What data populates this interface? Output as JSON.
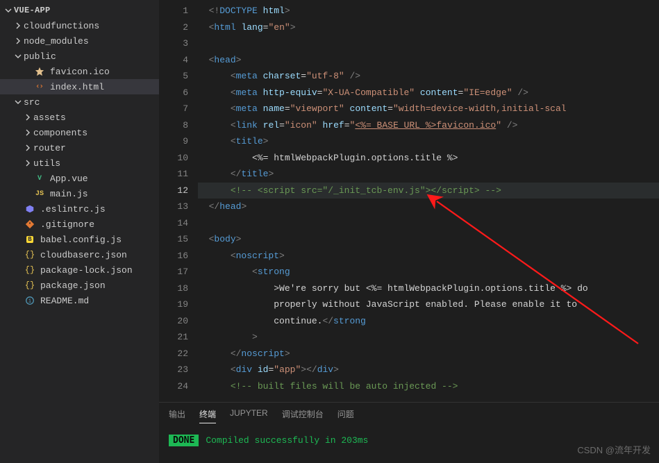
{
  "sidebar": {
    "root": "VUE-APP",
    "items": [
      {
        "type": "folder",
        "label": "cloudfunctions",
        "depth": 1,
        "expanded": false
      },
      {
        "type": "folder",
        "label": "node_modules",
        "depth": 1,
        "expanded": false
      },
      {
        "type": "folder",
        "label": "public",
        "depth": 1,
        "expanded": true
      },
      {
        "type": "file",
        "label": "favicon.ico",
        "depth": 2,
        "icon": "star"
      },
      {
        "type": "file",
        "label": "index.html",
        "depth": 2,
        "icon": "html",
        "selected": true
      },
      {
        "type": "folder",
        "label": "src",
        "depth": 1,
        "expanded": true
      },
      {
        "type": "folder",
        "label": "assets",
        "depth": 2,
        "expanded": false
      },
      {
        "type": "folder",
        "label": "components",
        "depth": 2,
        "expanded": false
      },
      {
        "type": "folder",
        "label": "router",
        "depth": 2,
        "expanded": false
      },
      {
        "type": "folder",
        "label": "utils",
        "depth": 2,
        "expanded": false
      },
      {
        "type": "file",
        "label": "App.vue",
        "depth": 2,
        "icon": "vue"
      },
      {
        "type": "file",
        "label": "main.js",
        "depth": 2,
        "icon": "js"
      },
      {
        "type": "file",
        "label": ".eslintrc.js",
        "depth": 1,
        "icon": "eslint"
      },
      {
        "type": "file",
        "label": ".gitignore",
        "depth": 1,
        "icon": "git"
      },
      {
        "type": "file",
        "label": "babel.config.js",
        "depth": 1,
        "icon": "babel"
      },
      {
        "type": "file",
        "label": "cloudbaserc.json",
        "depth": 1,
        "icon": "braces"
      },
      {
        "type": "file",
        "label": "package-lock.json",
        "depth": 1,
        "icon": "braces"
      },
      {
        "type": "file",
        "label": "package.json",
        "depth": 1,
        "icon": "braces"
      },
      {
        "type": "file",
        "label": "README.md",
        "depth": 1,
        "icon": "info"
      }
    ]
  },
  "editor": {
    "current_line": 12,
    "lines": [
      1,
      2,
      3,
      4,
      5,
      6,
      7,
      8,
      9,
      10,
      11,
      12,
      13,
      14,
      15,
      16,
      17,
      18,
      19,
      20,
      21,
      22,
      23,
      24
    ],
    "code": {
      "l1_doctype": "DOCTYPE",
      "l1_html": "html",
      "l2_tag": "html",
      "l2_attr": "lang",
      "l2_val": "\"en\"",
      "l4_tag": "head",
      "l5_tag": "meta",
      "l5_attr": "charset",
      "l5_val": "\"utf-8\"",
      "l6_tag": "meta",
      "l6_attr1": "http-equiv",
      "l6_val1": "\"X-UA-Compatible\"",
      "l6_attr2": "content",
      "l6_val2": "\"IE=edge\"",
      "l7_tag": "meta",
      "l7_attr1": "name",
      "l7_val1": "\"viewport\"",
      "l7_attr2": "content",
      "l7_val2": "\"width=device-width,initial-scal",
      "l8_tag": "link",
      "l8_attr1": "rel",
      "l8_val1": "\"icon\"",
      "l8_attr2": "href",
      "l8_val2a": "\"",
      "l8_link": "<%= BASE_URL %>favicon.ico",
      "l8_val2b": "\"",
      "l9_tag": "title",
      "l10_text": "<%= htmlWebpackPlugin.options.title %>",
      "l11_tag": "title",
      "l12_comment": "<!-- <script src=\"/_init_tcb-env.js\"></script> -->",
      "l13_tag": "head",
      "l15_tag": "body",
      "l16_tag": "noscript",
      "l17_tag": "strong",
      "l18_text_a": ">We're sorry but ",
      "l18_text_b": "<%= htmlWebpackPlugin.options.title %>",
      "l18_text_c": " do",
      "l19_text": "properly without JavaScript enabled. Please enable it to",
      "l20_text": "continue.",
      "l20_tag": "strong",
      "l22_tag": "noscript",
      "l23_tag": "div",
      "l23_attr": "id",
      "l23_val": "\"app\"",
      "l24_comment": "<!-- built files will be auto injected -->"
    }
  },
  "panel": {
    "tabs": [
      "输出",
      "终端",
      "JUPYTER",
      "调试控制台",
      "问题"
    ],
    "active_tab": 1,
    "done_label": "DONE",
    "compile_msg": "Compiled successfully in 203ms"
  },
  "watermark": "CSDN @流年开发"
}
